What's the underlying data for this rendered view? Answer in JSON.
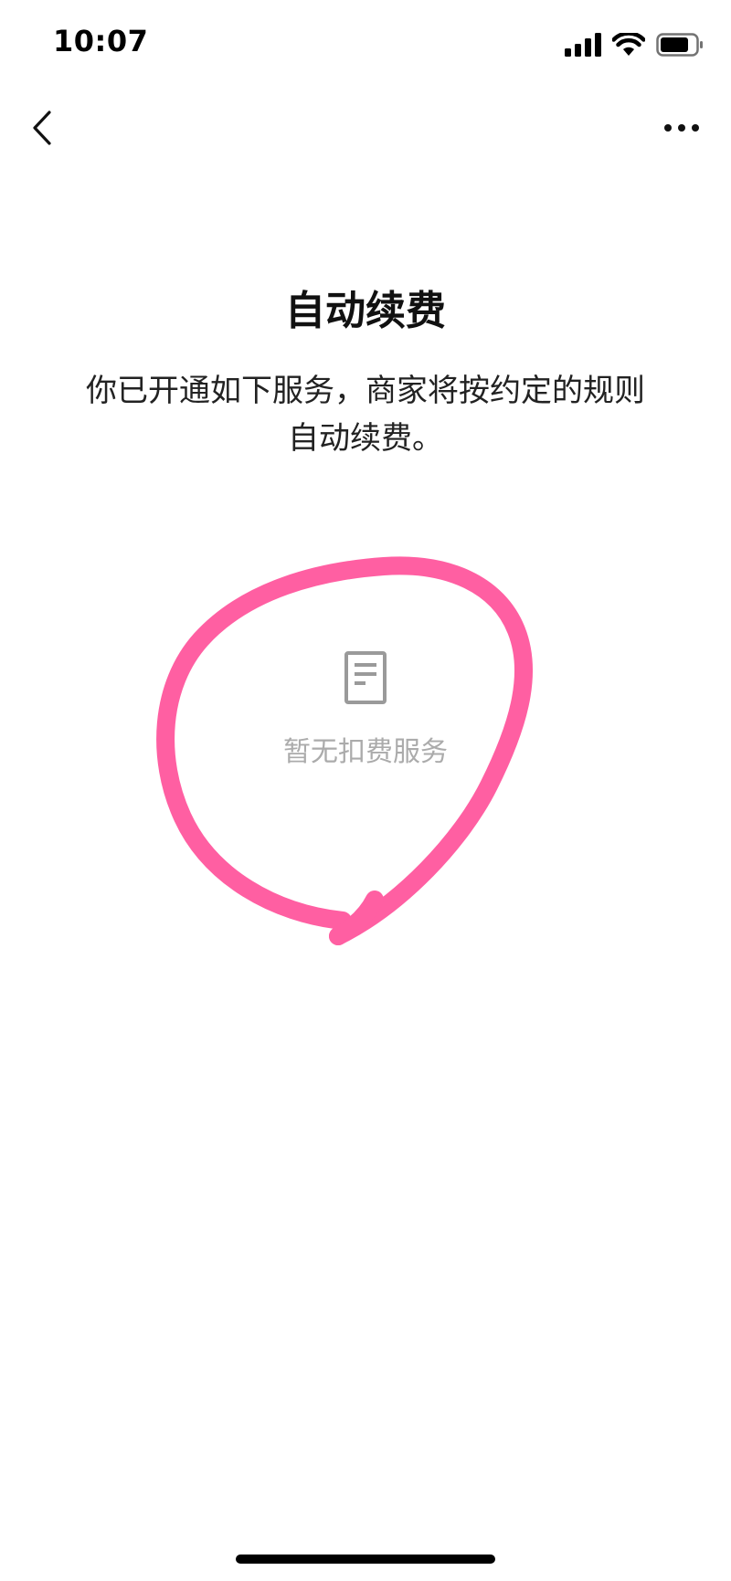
{
  "status_bar": {
    "time": "10:07",
    "icons": [
      "signal-icon",
      "wifi-icon",
      "battery-icon"
    ]
  },
  "nav": {
    "back_icon": "chevron-left-icon",
    "more_icon": "more-dots-icon"
  },
  "page": {
    "title": "自动续费",
    "description": "你已开通如下服务，商家将按约定的规则自动续费。"
  },
  "empty_state": {
    "icon": "document-icon",
    "text": "暂无扣费服务"
  },
  "colors": {
    "annotation": "#ff5fa2",
    "empty_text": "#ababab",
    "icon_gray": "#9a9a9a"
  }
}
